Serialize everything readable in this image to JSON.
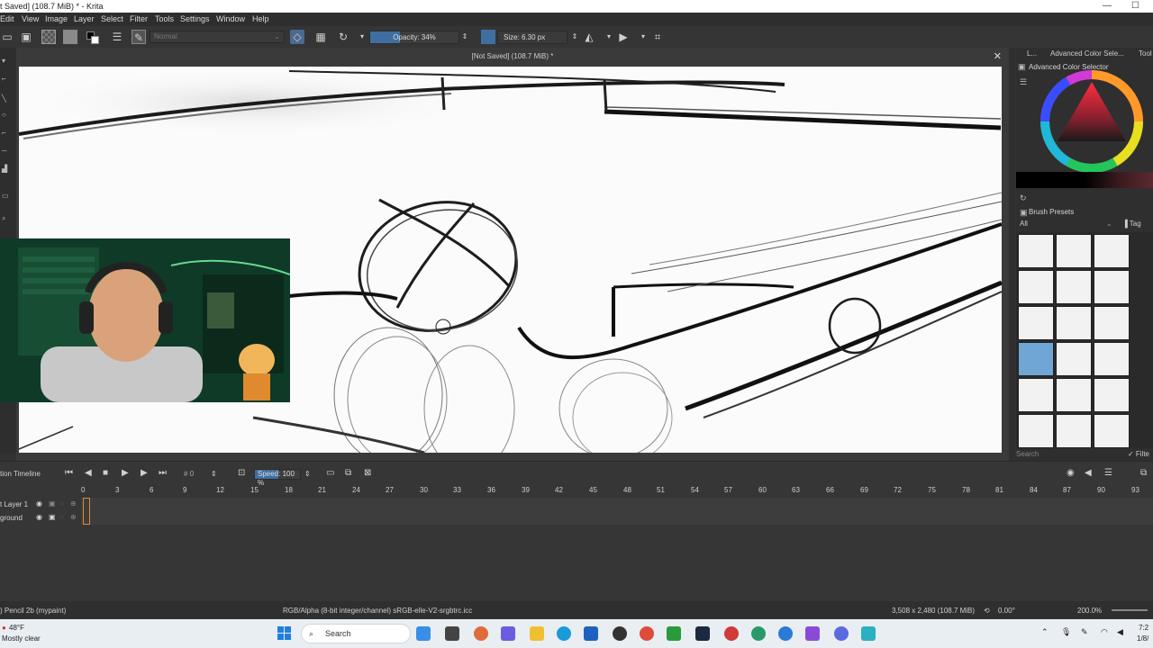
{
  "window": {
    "title": "t Saved]  (108.7 MiB) * - Krita",
    "minimize": "—",
    "maximize": "☐"
  },
  "menu": [
    "Edit",
    "View",
    "Image",
    "Layer",
    "Select",
    "Filter",
    "Tools",
    "Settings",
    "Window",
    "Help"
  ],
  "toolbar": {
    "blend_mode": "Normal",
    "opacity_label": "Opacity: 34%",
    "opacity_fraction": 0.34,
    "size_label": "Size: 6.30 px"
  },
  "document": {
    "title": "[Not Saved]  (108.7 MiB) *"
  },
  "dock": {
    "tab_short": "L...",
    "tab_color": "Advanced Color Sele...",
    "tab_tool": "Tool",
    "color_selector_title": "Advanced Color Selector",
    "brush_presets_title": "Brush Presets",
    "filter_all": "All",
    "tag_label": "Tag",
    "search_placeholder": "Search",
    "filter_label": "Filte"
  },
  "timeline": {
    "title": "tion Timeline",
    "frame_field": "0",
    "speed_label": "Speed: 100 %",
    "ruler": [
      "0",
      "3",
      "6",
      "9",
      "12",
      "15",
      "18",
      "21",
      "24",
      "27",
      "30",
      "33",
      "36",
      "39",
      "42",
      "45",
      "48",
      "51",
      "54",
      "57",
      "60",
      "63",
      "66",
      "69",
      "72",
      "75",
      "78",
      "81",
      "84",
      "87",
      "90",
      "93"
    ],
    "layers": [
      "t Layer 1",
      "ground"
    ]
  },
  "status": {
    "brush": ") Pencil 2b (mypaint)",
    "color_space": "RGB/Alpha (8-bit integer/channel)  sRGB-elle-V2-srgbtrc.icc",
    "dimensions": "3,508 x 2,480 (108.7 MiB)",
    "rotation": "0.00°",
    "zoom": "200.0%"
  },
  "taskbar": {
    "weather_temp": "48°F",
    "weather_desc": "Mostly clear",
    "search": "Search",
    "time": "7:2",
    "date": "1/8/"
  }
}
